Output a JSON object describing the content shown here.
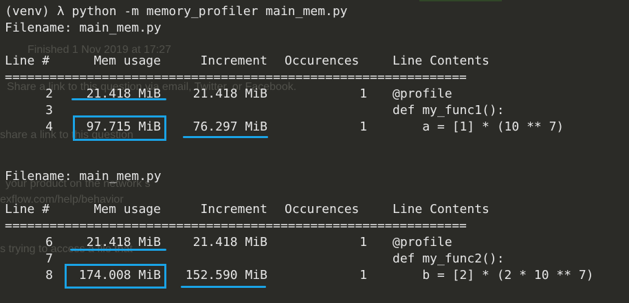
{
  "command": "(venv) λ python -m memory_profiler main_mem.py",
  "background_ghost_text": [
    "Finished 1 Nov 2019 at 17:27",
    "Share a link to this question via email, Twitter, or Facebook.",
    "share a link to this question",
    "your product on the network s",
    "exflow.com/help/behavior",
    "s trying to access a file that"
  ],
  "sections": [
    {
      "filename_line": "Filename: main_mem.py",
      "headers": {
        "line": "Line #",
        "mem": "Mem usage",
        "inc": "Increment",
        "occ": "Occurences",
        "contents": "Line Contents"
      },
      "separator": "==============================================================",
      "rows": [
        {
          "line": "2",
          "mem": "21.418 MiB",
          "inc": "21.418 MiB",
          "occ": "1",
          "contents": "@profile"
        },
        {
          "line": "3",
          "mem": "",
          "inc": "",
          "occ": "",
          "contents": "def my_func1():"
        },
        {
          "line": "4",
          "mem": "97.715 MiB",
          "inc": "76.297 MiB",
          "occ": "1",
          "contents": "    a = [1] * (10 ** 7)"
        }
      ]
    },
    {
      "filename_line": "Filename: main_mem.py",
      "headers": {
        "line": "Line #",
        "mem": "Mem usage",
        "inc": "Increment",
        "occ": "Occurences",
        "contents": "Line Contents"
      },
      "separator": "==============================================================",
      "rows": [
        {
          "line": "6",
          "mem": "21.418 MiB",
          "inc": "21.418 MiB",
          "occ": "1",
          "contents": "@profile"
        },
        {
          "line": "7",
          "mem": "",
          "inc": "",
          "occ": "",
          "contents": "def my_func2():"
        },
        {
          "line": "8",
          "mem": "174.008 MiB",
          "inc": "152.590 MiB",
          "occ": "1",
          "contents": "    b = [2] * (2 * 10 ** 7)"
        }
      ]
    }
  ],
  "colors": {
    "background": "#2b2b27",
    "text": "#e7e7e7",
    "annotation": "#1aa3e6"
  }
}
